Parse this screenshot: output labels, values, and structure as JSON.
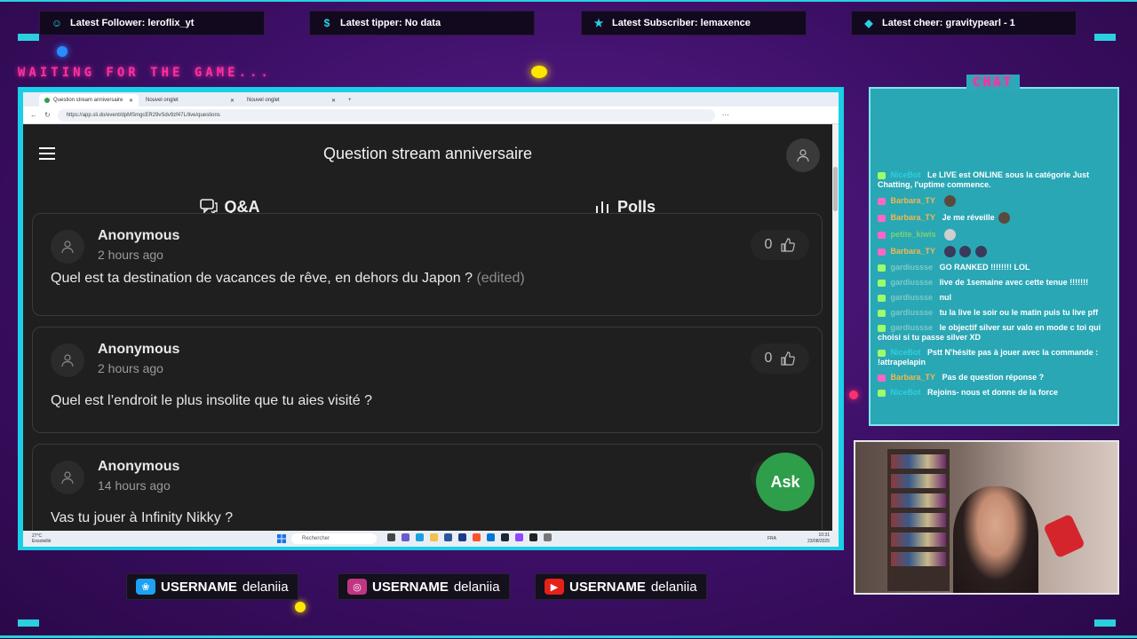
{
  "overlay": {
    "tickers": [
      {
        "icon": "person-icon",
        "glyph": "☺",
        "text": "Latest Follower: leroflix_yt"
      },
      {
        "icon": "dollar-icon",
        "glyph": "$",
        "text": "Latest tipper: No data"
      },
      {
        "icon": "star-icon",
        "glyph": "★",
        "text": "Latest Subscriber: lemaxence"
      },
      {
        "icon": "diamond-icon",
        "glyph": "◆",
        "text": "Latest cheer: gravitypearl - 1"
      }
    ],
    "waiting_text": "WAITING FOR THE GAME...",
    "chat_title": "CHAT",
    "accent": "#2ad0e0",
    "pink": "#ff2f9e"
  },
  "browser": {
    "tabs": [
      "Question stream anniversaire",
      "Nouvel onglet",
      "Nouvel onglet"
    ],
    "url": "https://app.sli.do/event/dpMSmgcER29vSdv9zf47L/live/questions"
  },
  "app": {
    "title": "Question stream anniversaire",
    "tabs": [
      "Q&A",
      "Polls"
    ],
    "ask_label": "Ask",
    "questions": [
      {
        "author": "Anonymous",
        "time": "2 hours ago",
        "votes": "0",
        "text": "Quel est ta destination de vacances de rêve, en dehors du Japon ?",
        "edited": "(edited)"
      },
      {
        "author": "Anonymous",
        "time": "2 hours ago",
        "votes": "0",
        "text": "Quel est l’endroit le plus insolite que tu aies visité ?",
        "edited": ""
      },
      {
        "author": "Anonymous",
        "time": "14 hours ago",
        "votes": "0",
        "text": "Vas tu jouer à Infinity Nikky ?",
        "edited": ""
      }
    ]
  },
  "taskbar": {
    "weather_temp": "27°C",
    "weather_desc": "Ensoleillé",
    "search": "Rechercher",
    "lang": "FRA",
    "time": "10:31",
    "date": "23/08/2025"
  },
  "chat": [
    {
      "user": "NiceBot",
      "user_color": "#2ad0e0",
      "badge": "#9cff6a",
      "text": "Le LIVE est ONLINE sous la catégorie Just Chatting, l'uptime commence.",
      "emotes": 0
    },
    {
      "user": "Barbara_TY",
      "user_color": "#f2b84b",
      "badge": "#ff66c4",
      "text": "",
      "emotes": 1
    },
    {
      "user": "Barbara_TY",
      "user_color": "#f2b84b",
      "badge": "#ff66c4",
      "text": "Je me réveille",
      "emotes": 1
    },
    {
      "user": "petite_kiwis",
      "user_color": "#7fd36a",
      "badge": "#ff66c4",
      "text": "",
      "emotes": 1
    },
    {
      "user": "Barbara_TY",
      "user_color": "#f2b84b",
      "badge": "#ff66c4",
      "text": "",
      "emotes": 3
    },
    {
      "user": "gardiussse",
      "user_color": "#7dc8c8",
      "badge": "#9cff6a",
      "text": "GO RANKED !!!!!!!! LOL",
      "emotes": 0
    },
    {
      "user": "gardiussse",
      "user_color": "#7dc8c8",
      "badge": "#9cff6a",
      "text": "live de 1semaine avec cette tenue !!!!!!!",
      "emotes": 0
    },
    {
      "user": "gardiussse",
      "user_color": "#7dc8c8",
      "badge": "#9cff6a",
      "text": "nul",
      "emotes": 0
    },
    {
      "user": "gardiussse",
      "user_color": "#7dc8c8",
      "badge": "#9cff6a",
      "text": "tu la live le soir ou le matin puis tu live pff",
      "emotes": 0
    },
    {
      "user": "gardiussse",
      "user_color": "#7dc8c8",
      "badge": "#9cff6a",
      "text": "le objectif silver sur valo en mode c toi qui choisi si tu passe silver XD",
      "emotes": 0
    },
    {
      "user": "NiceBot",
      "user_color": "#2ad0e0",
      "badge": "#9cff6a",
      "text": "Pstt N'hésite pas à jouer avec la commande : !attrapelapin",
      "emotes": 0
    },
    {
      "user": "Barbara_TY",
      "user_color": "#f2b84b",
      "badge": "#ff66c4",
      "text": "Pas de question réponse ?",
      "emotes": 0
    },
    {
      "user": "NiceBot",
      "user_color": "#2ad0e0",
      "badge": "#9cff6a",
      "text": "Rejoins- nous et donne de la force",
      "emotes": 0
    }
  ],
  "socials": [
    {
      "icon": "twitter-icon",
      "glyph": "❀",
      "color": "#1da1f2",
      "label": "USERNAME",
      "handle": "delaniia"
    },
    {
      "icon": "instagram-icon",
      "glyph": "◎",
      "color": "#c13584",
      "label": "USERNAME",
      "handle": "delaniia"
    },
    {
      "icon": "youtube-icon",
      "glyph": "▶",
      "color": "#e62117",
      "label": "USERNAME",
      "handle": "delaniia"
    }
  ]
}
